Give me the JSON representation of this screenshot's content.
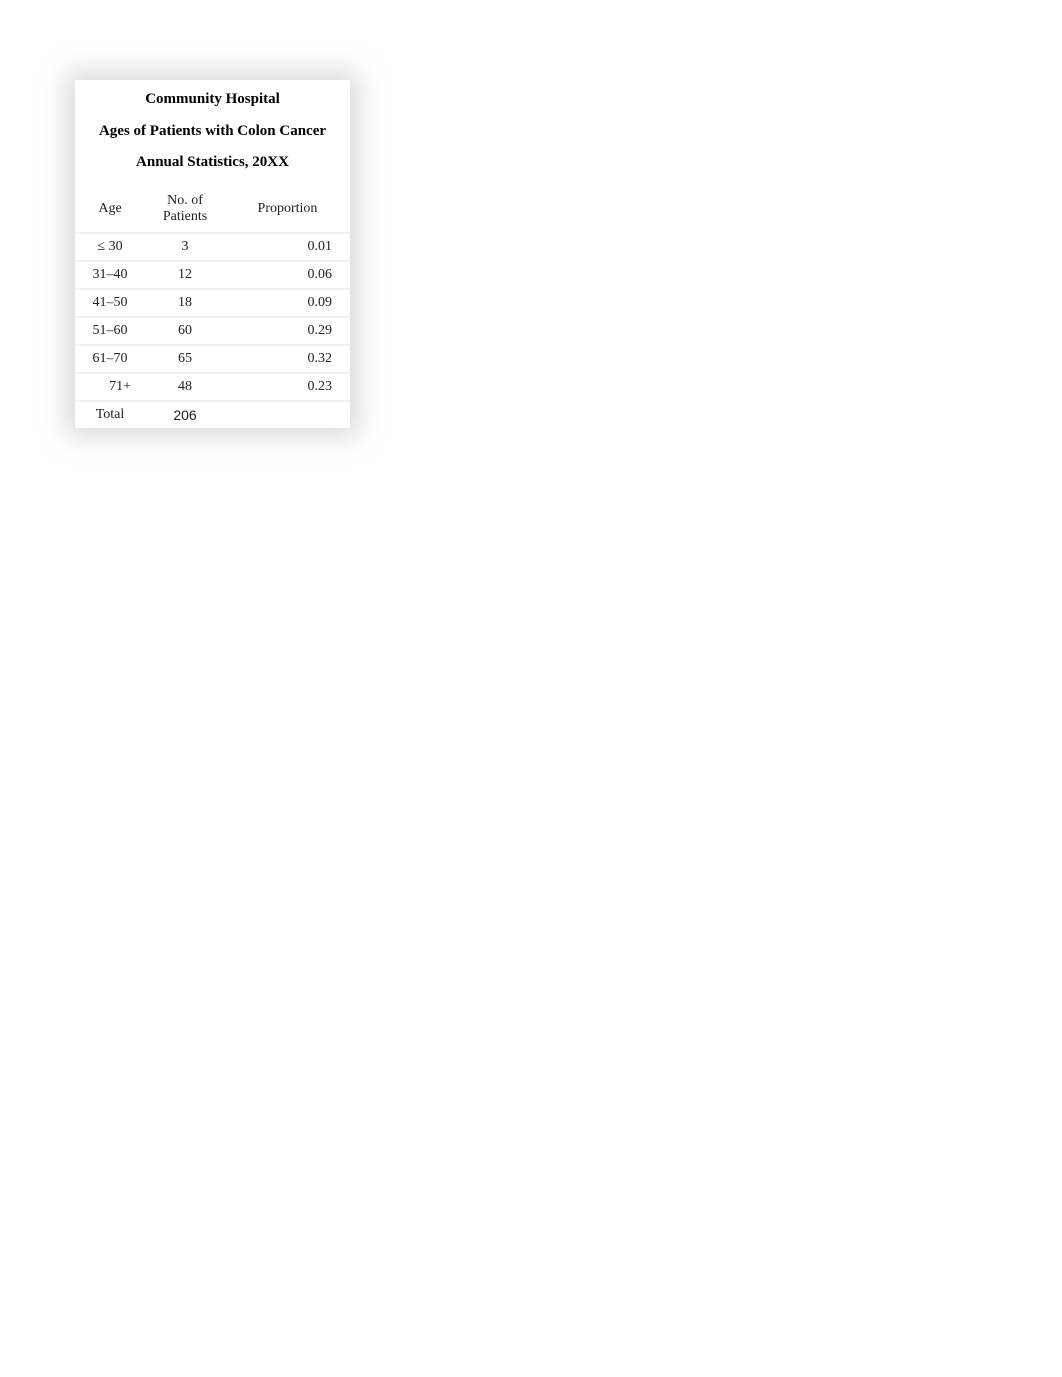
{
  "header": {
    "line1": "Community Hospital",
    "line2": "Ages of Patients with Colon Cancer",
    "line3": "Annual Statistics, 20XX"
  },
  "columns": {
    "age": "Age",
    "patients": "No. of Patients",
    "proportion": "Proportion"
  },
  "rows": [
    {
      "age": "≤ 30",
      "patients": "3",
      "proportion": "0.01"
    },
    {
      "age": "31–40",
      "patients": "12",
      "proportion": "0.06"
    },
    {
      "age": "41–50",
      "patients": "18",
      "proportion": "0.09"
    },
    {
      "age": "51–60",
      "patients": "60",
      "proportion": "0.29"
    },
    {
      "age": "61–70",
      "patients": "65",
      "proportion": "0.32"
    },
    {
      "age": "71+",
      "patients": "48",
      "proportion": "0.23"
    }
  ],
  "total": {
    "label": "Total",
    "value": "206"
  },
  "chart_data": {
    "type": "table",
    "title": "Community Hospital — Ages of Patients with Colon Cancer — Annual Statistics, 20XX",
    "columns": [
      "Age",
      "No. of Patients",
      "Proportion"
    ],
    "rows": [
      [
        "≤ 30",
        3,
        0.01
      ],
      [
        "31–40",
        12,
        0.06
      ],
      [
        "41–50",
        18,
        0.09
      ],
      [
        "51–60",
        60,
        0.29
      ],
      [
        "61–70",
        65,
        0.32
      ],
      [
        "71+",
        48,
        0.23
      ]
    ],
    "total_patients": 206
  }
}
